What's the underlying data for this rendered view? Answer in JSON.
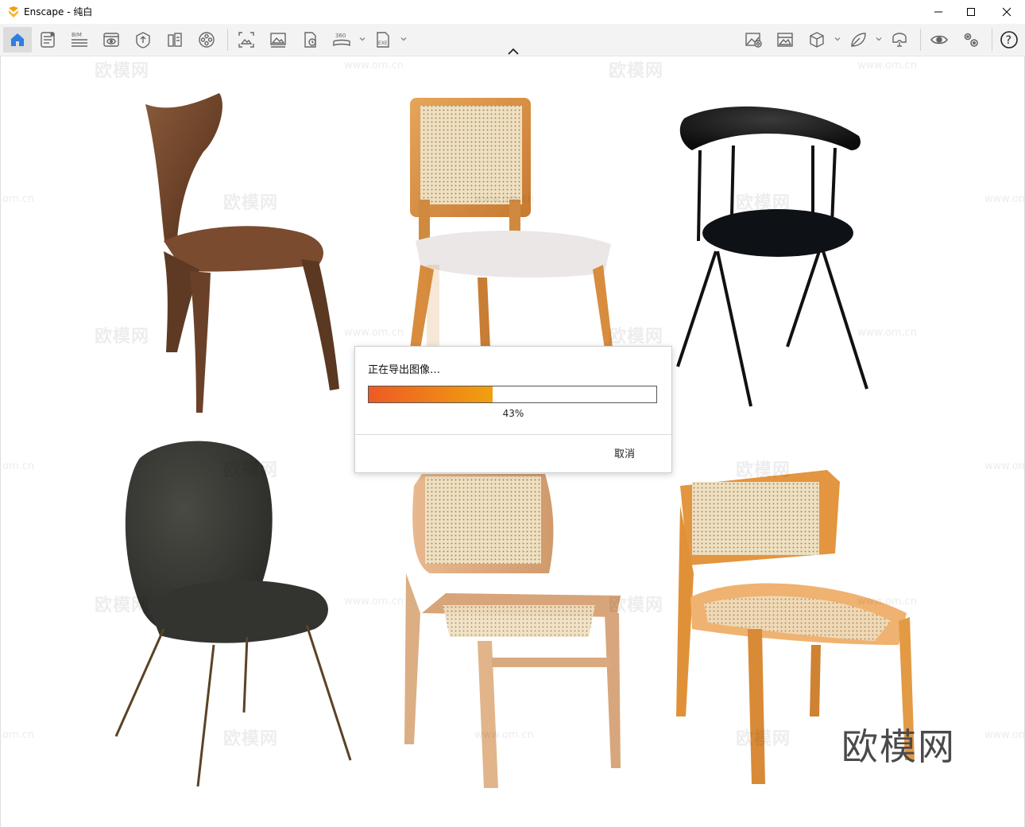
{
  "window": {
    "title": "Enscape - 纯白",
    "minimize_label": "minimize",
    "maximize_label": "maximize",
    "close_label": "close"
  },
  "toolbar": {
    "icons": [
      "home-icon",
      "document-icon",
      "bim-icon",
      "view-icon",
      "asset-library-icon",
      "material-icon",
      "video-editor-icon",
      "screenshot-icon",
      "image-export-icon",
      "batch-export-icon",
      "panorama-360-icon",
      "exe-export-icon",
      "visual-settings-icon",
      "atmosphere-icon",
      "cube-icon",
      "leaf-icon",
      "vr-headset-icon",
      "eye-icon",
      "settings-icon",
      "help-icon"
    ],
    "bim_text": "BIM",
    "pano_text": "360",
    "exe_text": "EXE",
    "help_text": "?"
  },
  "watermark": {
    "site_text": "www.om.cn",
    "site_short": "om.cn",
    "cn_text": "欧模网",
    "brand_text": "欧模网"
  },
  "dialog": {
    "title": "正在导出图像…",
    "progress": 0.43,
    "progress_text": "43%",
    "cancel_label": "取消"
  },
  "colors": {
    "accent_orange": "#f0a10e",
    "progress_start": "#ee5a24",
    "home_active_blue": "#2f7de1"
  }
}
